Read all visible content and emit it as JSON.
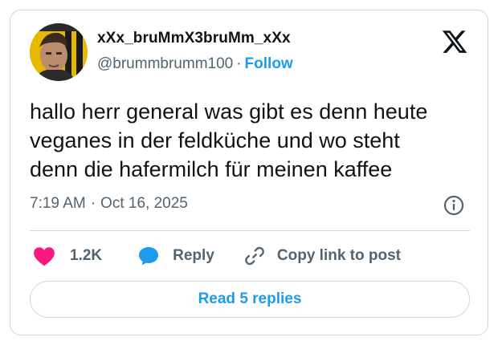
{
  "author": {
    "display_name": "xXx_bruMmX3bruMm_xXx",
    "handle": "@brummbrumm100",
    "separator": "·",
    "follow_label": "Follow"
  },
  "tweet": {
    "text": "hallo herr general was gibt es denn heute\nveganes in der feldküche und wo steht\ndenn die hafermilch für meinen kaffee",
    "time": "7:19 AM",
    "separator": "·",
    "date": "Oct 16, 2025"
  },
  "actions": {
    "like_count": "1.2K",
    "reply_label": "Reply",
    "copy_label": "Copy link to post"
  },
  "read_replies_label": "Read 5 replies",
  "icons": {
    "logo": "x-logo-icon",
    "info": "info-icon",
    "like": "heart-icon",
    "reply": "speech-bubble-icon",
    "copy": "link-icon"
  },
  "colors": {
    "accent": "#1d9bf0",
    "like": "#f91880",
    "muted_text": "#536471",
    "border": "#cfd9de",
    "text": "#0f1419"
  }
}
